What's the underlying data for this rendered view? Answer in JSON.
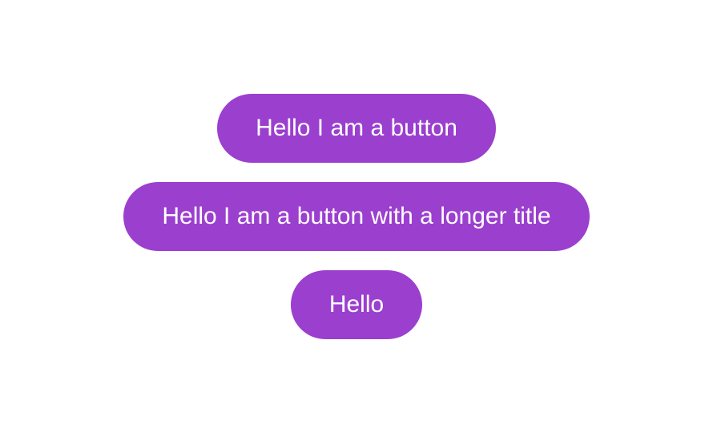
{
  "buttons": [
    {
      "label": "Hello I am a button"
    },
    {
      "label": "Hello I am a button with a longer title"
    },
    {
      "label": "Hello"
    }
  ],
  "colors": {
    "button_bg": "#9b3fcf",
    "button_text": "#ffffff"
  }
}
